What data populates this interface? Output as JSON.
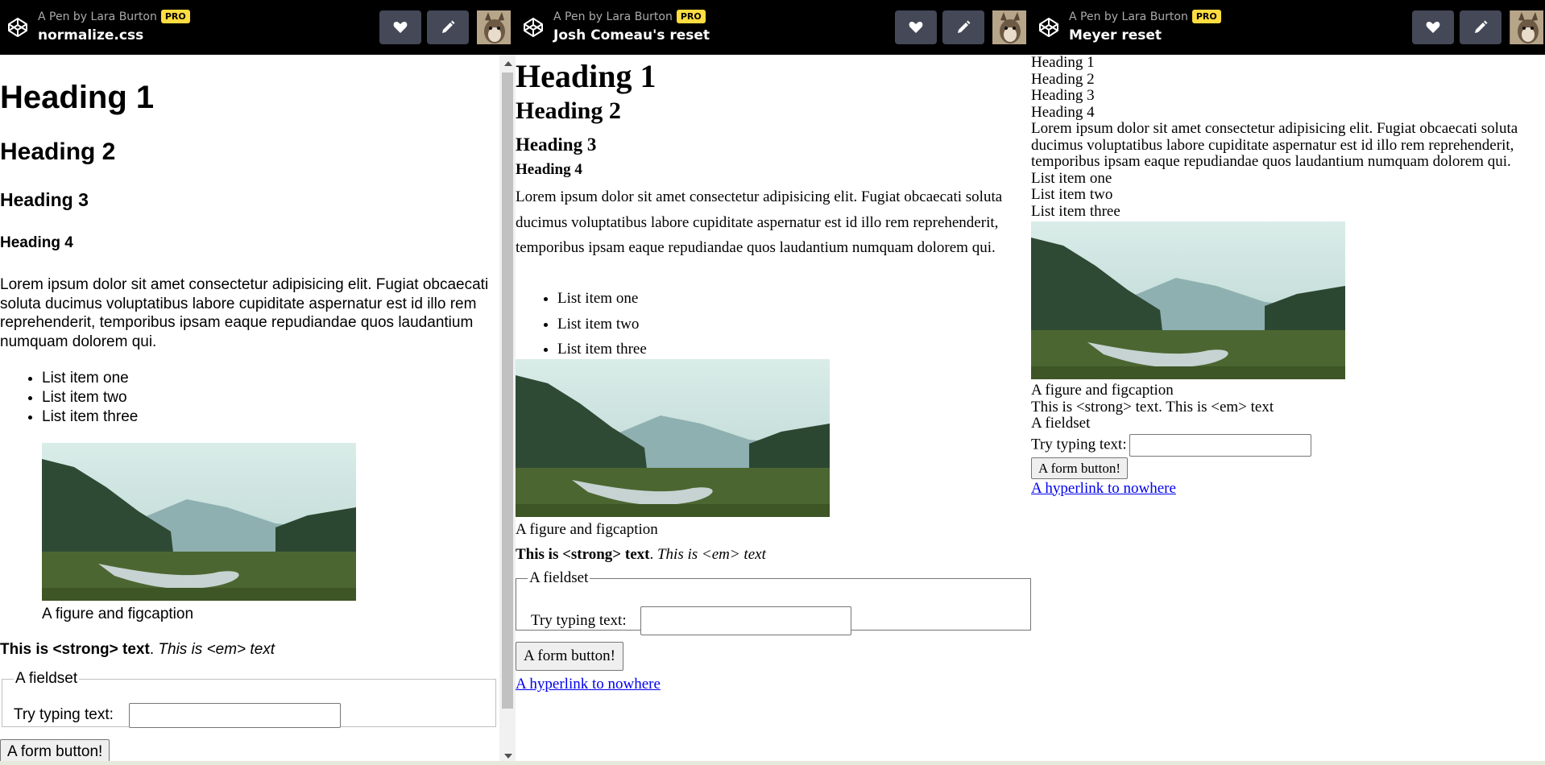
{
  "panes": [
    {
      "byline": "A Pen by Lara Burton",
      "pro": "PRO",
      "title": "normalize.css"
    },
    {
      "byline": "A Pen by Lara Burton",
      "pro": "PRO",
      "title": "Josh Comeau's reset"
    },
    {
      "byline": "A Pen by Lara Burton",
      "pro": "PRO",
      "title": "Meyer reset"
    }
  ],
  "demo": {
    "h1": "Heading 1",
    "h2": "Heading 2",
    "h3": "Heading 3",
    "h4": "Heading 4",
    "paragraph": "Lorem ipsum dolor sit amet consectetur adipisicing elit. Fugiat obcaecati soluta ducimus voluptatibus labore cupiditate aspernatur est id illo rem reprehenderit, temporibus ipsam eaque repudiandae quos laudantium numquam dolorem qui.",
    "list": [
      "List item one",
      "List item two",
      "List item three"
    ],
    "figcaption": "A figure and figcaption",
    "strong": "This is <strong> text",
    "dot": ".",
    "em": "This is <em> text",
    "legend": "A fieldset",
    "input_label": "Try typing text:",
    "button": "A form button!",
    "link": "A hyperlink to nowhere"
  },
  "icons": {
    "logo": "codepen-logo-icon",
    "heart": "heart-icon",
    "pencil": "pencil-icon",
    "avatar": "avatar"
  },
  "colors": {
    "header_bg": "#000000",
    "button_bg": "#444857",
    "pro_badge": "#ffdd40",
    "link": "#0000ee"
  }
}
